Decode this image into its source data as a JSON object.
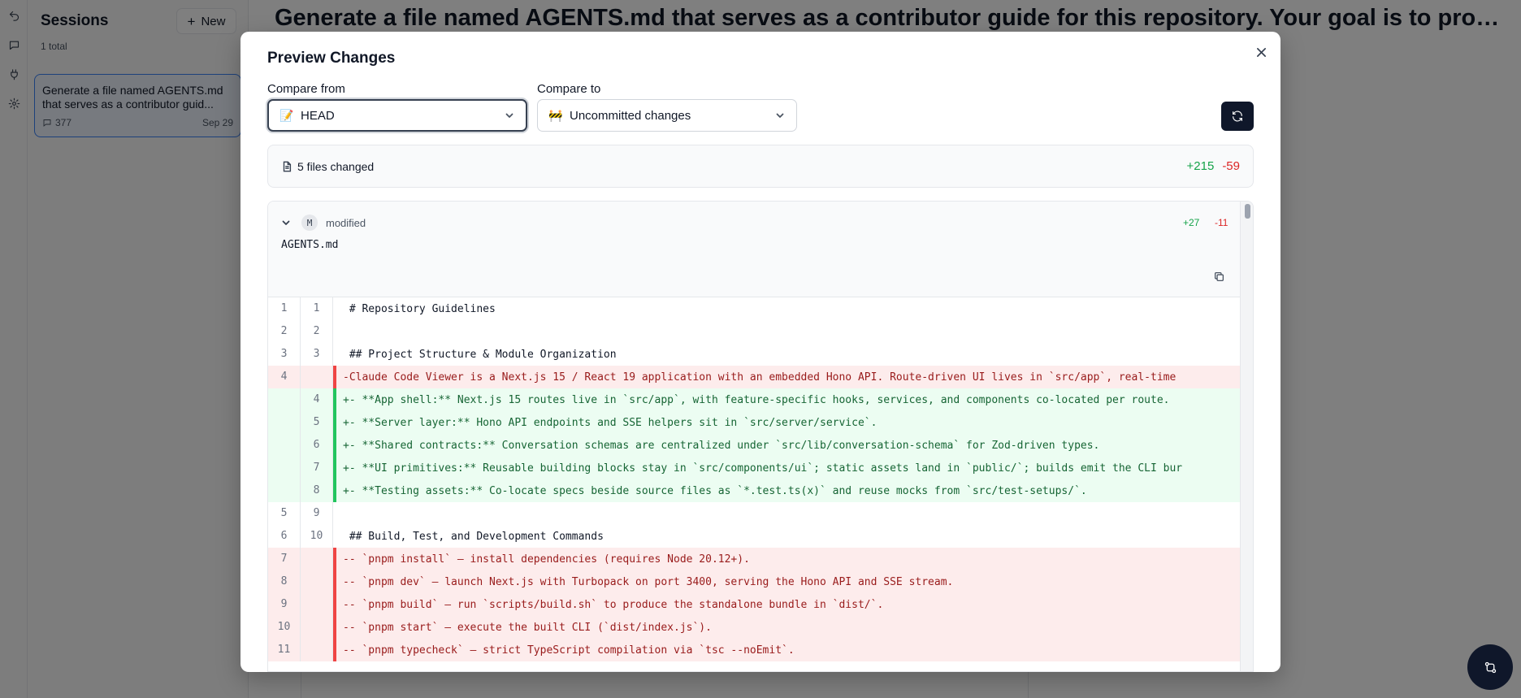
{
  "sessions": {
    "title": "Sessions",
    "new_label": "New",
    "count": "1 total",
    "items": [
      {
        "title": "Generate a file named AGENTS.md that serves as a contributor guid...",
        "messages": "377",
        "date": "Sep 29"
      }
    ]
  },
  "main": {
    "title": "Generate a file named AGENTS.md that serves as a contributor guide for this repository. Your goal is to prod..."
  },
  "modal": {
    "title": "Preview Changes",
    "compare_from_label": "Compare from",
    "compare_from_value": "HEAD",
    "compare_from_emoji": "📝",
    "compare_to_label": "Compare to",
    "compare_to_value": "Uncommitted changes",
    "compare_to_emoji": "🚧",
    "summary": {
      "files_changed": "5 files changed",
      "additions": "+215",
      "deletions": "-59"
    },
    "file": {
      "badge": "M",
      "status": "modified",
      "name": "AGENTS.md",
      "additions": "+27",
      "deletions": "-11"
    },
    "diff_lines": [
      {
        "type": "ctx",
        "old": "1",
        "new": "1",
        "text": " # Repository Guidelines"
      },
      {
        "type": "ctx",
        "old": "2",
        "new": "2",
        "text": ""
      },
      {
        "type": "ctx",
        "old": "3",
        "new": "3",
        "text": " ## Project Structure & Module Organization"
      },
      {
        "type": "del",
        "old": "4",
        "new": "",
        "text": "-Claude Code Viewer is a Next.js 15 / React 19 application with an embedded Hono API. Route-driven UI lives in `src/app`, real-time"
      },
      {
        "type": "add",
        "old": "",
        "new": "4",
        "text": "+- **App shell:** Next.js 15 routes live in `src/app`, with feature-specific hooks, services, and components co-located per route."
      },
      {
        "type": "add",
        "old": "",
        "new": "5",
        "text": "+- **Server layer:** Hono API endpoints and SSE helpers sit in `src/server/service`."
      },
      {
        "type": "add",
        "old": "",
        "new": "6",
        "text": "+- **Shared contracts:** Conversation schemas are centralized under `src/lib/conversation-schema` for Zod-driven types."
      },
      {
        "type": "add",
        "old": "",
        "new": "7",
        "text": "+- **UI primitives:** Reusable building blocks stay in `src/components/ui`; static assets land in `public/`; builds emit the CLI bur"
      },
      {
        "type": "add",
        "old": "",
        "new": "8",
        "text": "+- **Testing assets:** Co-locate specs beside source files as `*.test.ts(x)` and reuse mocks from `src/test-setups/`."
      },
      {
        "type": "ctx",
        "old": "5",
        "new": "9",
        "text": ""
      },
      {
        "type": "ctx",
        "old": "6",
        "new": "10",
        "text": " ## Build, Test, and Development Commands"
      },
      {
        "type": "del",
        "old": "7",
        "new": "",
        "text": "-- `pnpm install` — install dependencies (requires Node 20.12+)."
      },
      {
        "type": "del",
        "old": "8",
        "new": "",
        "text": "-- `pnpm dev` — launch Next.js with Turbopack on port 3400, serving the Hono API and SSE stream."
      },
      {
        "type": "del",
        "old": "9",
        "new": "",
        "text": "-- `pnpm build` — run `scripts/build.sh` to produce the standalone bundle in `dist/`."
      },
      {
        "type": "del",
        "old": "10",
        "new": "",
        "text": "-- `pnpm start` — execute the built CLI (`dist/index.js`)."
      },
      {
        "type": "del",
        "old": "11",
        "new": "",
        "text": "-- `pnpm typecheck` — strict TypeScript compilation via `tsc --noEmit`."
      }
    ]
  }
}
